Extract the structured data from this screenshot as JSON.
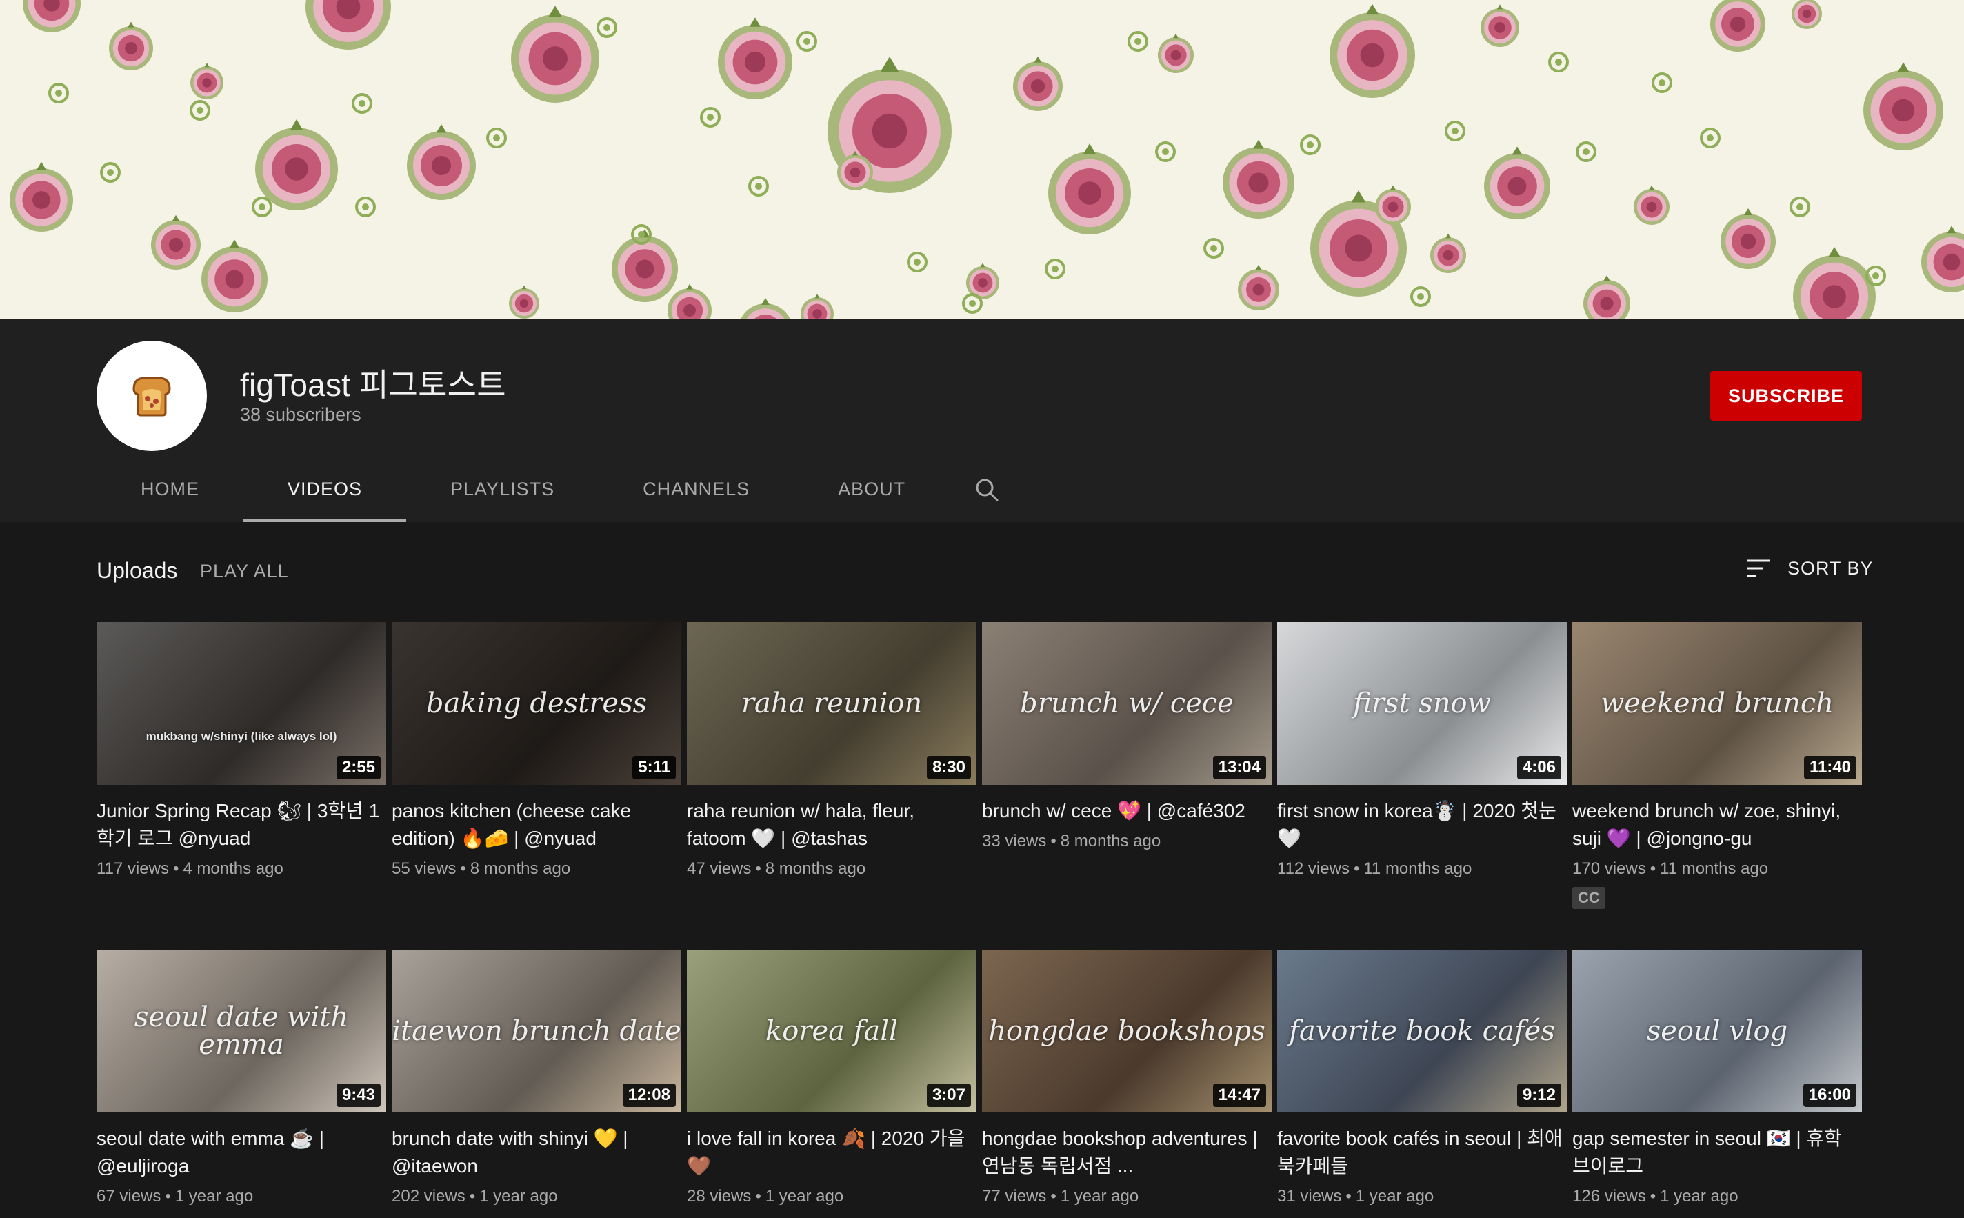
{
  "channel": {
    "name": "figToast 피그토스트",
    "subscribers": "38 subscribers",
    "subscribe_label": "SUBSCRIBE"
  },
  "tabs": [
    {
      "label": "HOME",
      "active": false
    },
    {
      "label": "VIDEOS",
      "active": true
    },
    {
      "label": "PLAYLISTS",
      "active": false
    },
    {
      "label": "CHANNELS",
      "active": false
    },
    {
      "label": "ABOUT",
      "active": false
    }
  ],
  "uploads": {
    "title": "Uploads",
    "play_all": "PLAY ALL",
    "sort_by": "SORT BY"
  },
  "videos": [
    {
      "title": "Junior Spring Recap 🐿 | 3학년 1학기 로그 @nyuad",
      "views": "117 views",
      "age": "4 months ago",
      "duration": "2:55",
      "overlay": "mukbang w/shinyi (like always lol)",
      "cc": ""
    },
    {
      "title": "panos kitchen (cheese cake edition) 🔥🧀 | @nyuad",
      "views": "55 views",
      "age": "8 months ago",
      "duration": "5:11",
      "overlay": "baking destress",
      "cc": ""
    },
    {
      "title": "raha reunion w/ hala, fleur, fatoom 🤍 | @tashas",
      "views": "47 views",
      "age": "8 months ago",
      "duration": "8:30",
      "overlay": "raha reunion",
      "cc": ""
    },
    {
      "title": "brunch w/ cece 💖 | @café302",
      "views": "33 views",
      "age": "8 months ago",
      "duration": "13:04",
      "overlay": "brunch w/ cece",
      "cc": ""
    },
    {
      "title": "first snow in korea☃️ | 2020 첫눈 🤍",
      "views": "112 views",
      "age": "11 months ago",
      "duration": "4:06",
      "overlay": "first snow",
      "cc": ""
    },
    {
      "title": "weekend brunch w/ zoe, shinyi, suji 💜 | @jongno-gu",
      "views": "170 views",
      "age": "11 months ago",
      "duration": "11:40",
      "overlay": "weekend brunch",
      "cc": "CC"
    },
    {
      "title": "seoul date with emma ☕️ | @euljiroga",
      "views": "67 views",
      "age": "1 year ago",
      "duration": "9:43",
      "overlay": "seoul date with emma",
      "cc": ""
    },
    {
      "title": "brunch date with shinyi 💛 | @itaewon",
      "views": "202 views",
      "age": "1 year ago",
      "duration": "12:08",
      "overlay": "itaewon brunch date",
      "cc": ""
    },
    {
      "title": "i love fall in korea 🍂 | 2020 가을 🤎",
      "views": "28 views",
      "age": "1 year ago",
      "duration": "3:07",
      "overlay": "korea        fall",
      "cc": ""
    },
    {
      "title": "hongdae bookshop adventures | 연남동 독립서점 ...",
      "views": "77 views",
      "age": "1 year ago",
      "duration": "14:47",
      "overlay": "hongdae bookshops",
      "cc": ""
    },
    {
      "title": "favorite book cafés in seoul | 최애 북카페들",
      "views": "31 views",
      "age": "1 year ago",
      "duration": "9:12",
      "overlay": "favorite book cafés",
      "cc": ""
    },
    {
      "title": "gap semester in seoul 🇰🇷 | 휴학 브이로그",
      "views": "126 views",
      "age": "1 year ago",
      "duration": "16:00",
      "overlay": "seoul vlog",
      "cc": ""
    }
  ],
  "colors": {
    "subscribe": "#cc0000",
    "banner_bg": "#f5f3e6",
    "fig_flesh": "#c45a76",
    "fig_skin": "#8fae58"
  },
  "icons": {
    "search": "search-icon",
    "sort": "sort-icon",
    "avatar": "toast-icon"
  }
}
